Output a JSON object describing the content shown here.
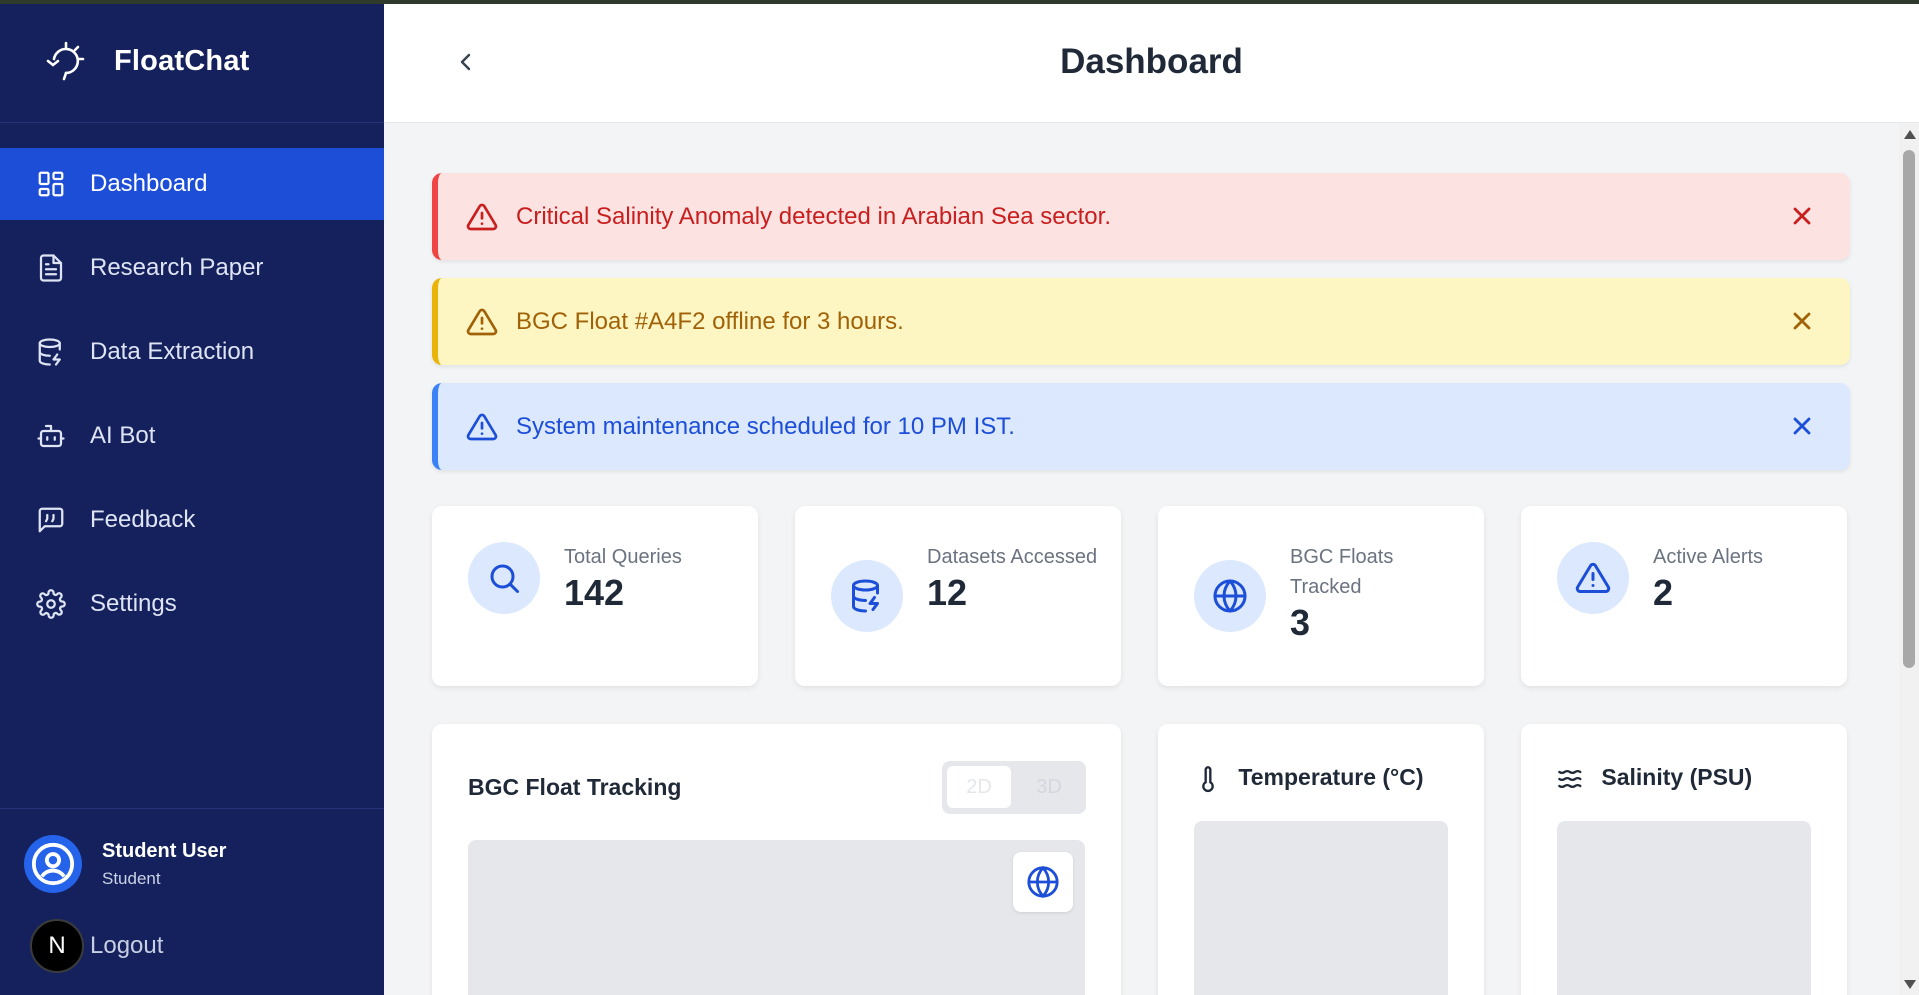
{
  "app": {
    "name": "FloatChat"
  },
  "sidebar": {
    "items": [
      {
        "label": "Dashboard",
        "icon": "dashboard-grid-icon",
        "active": true
      },
      {
        "label": "Research Paper",
        "icon": "document-icon",
        "active": false
      },
      {
        "label": "Data Extraction",
        "icon": "database-icon",
        "active": false
      },
      {
        "label": "AI Bot",
        "icon": "robot-icon",
        "active": false
      },
      {
        "label": "Feedback",
        "icon": "chat-quote-icon",
        "active": false
      },
      {
        "label": "Settings",
        "icon": "gear-icon",
        "active": false
      }
    ],
    "user": {
      "name": "Student User",
      "role": "Student"
    },
    "logout": {
      "badge": "N",
      "label": "Logout"
    }
  },
  "header": {
    "title": "Dashboard"
  },
  "alerts": [
    {
      "level": "critical",
      "text": "Critical Salinity Anomaly detected in Arabian Sea sector.",
      "color": "#c81e1e"
    },
    {
      "level": "warning",
      "text": "BGC Float #A4F2 offline for 3 hours.",
      "color": "#a16207"
    },
    {
      "level": "info",
      "text": "System maintenance scheduled for 10 PM IST.",
      "color": "#1d4ed8"
    }
  ],
  "stats": [
    {
      "label": "Total Queries",
      "value": "142",
      "icon": "search-icon"
    },
    {
      "label": "Datasets Accessed",
      "value": "12",
      "icon": "database-bolt-icon"
    },
    {
      "label": "BGC Floats Tracked",
      "value": "3",
      "icon": "globe-icon"
    },
    {
      "label": "Active Alerts",
      "value": "2",
      "icon": "warning-triangle-icon"
    }
  ],
  "panels": {
    "tracking": {
      "title": "BGC Float Tracking",
      "toggle": [
        "2D",
        "3D"
      ],
      "selected": "2D"
    },
    "temperature": {
      "title": "Temperature (°C)"
    },
    "salinity": {
      "title": "Salinity (PSU)"
    }
  },
  "colors": {
    "sidebar": "#14215c",
    "accent": "#1d4ed8"
  }
}
